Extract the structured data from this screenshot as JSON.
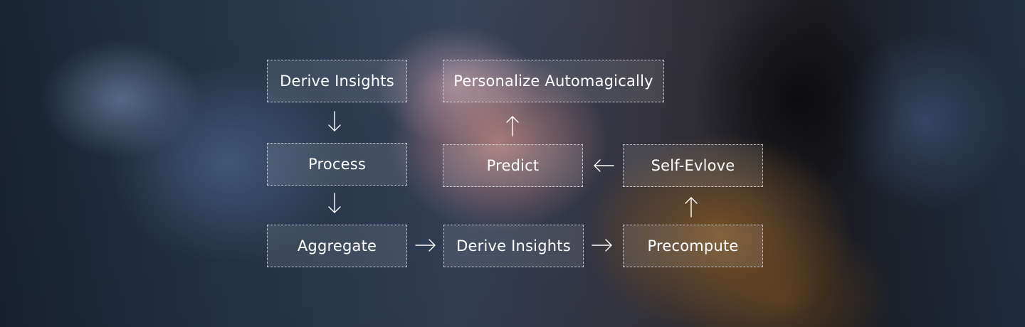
{
  "diagram": {
    "nodes": {
      "derive_insights_top": "Derive Insights",
      "personalize": "Personalize Automagically",
      "process": "Process",
      "predict": "Predict",
      "self_evolve": "Self-Evlove",
      "aggregate": "Aggregate",
      "derive_insights_bottom": "Derive Insights",
      "precompute": "Precompute"
    },
    "edges": [
      {
        "from": "derive_insights_top",
        "to": "process"
      },
      {
        "from": "process",
        "to": "aggregate"
      },
      {
        "from": "aggregate",
        "to": "derive_insights_bottom"
      },
      {
        "from": "derive_insights_bottom",
        "to": "precompute"
      },
      {
        "from": "precompute",
        "to": "self_evolve"
      },
      {
        "from": "self_evolve",
        "to": "predict"
      },
      {
        "from": "predict",
        "to": "personalize"
      }
    ],
    "colors": {
      "text": "#ffffff",
      "border": "#e8e8ee"
    }
  }
}
